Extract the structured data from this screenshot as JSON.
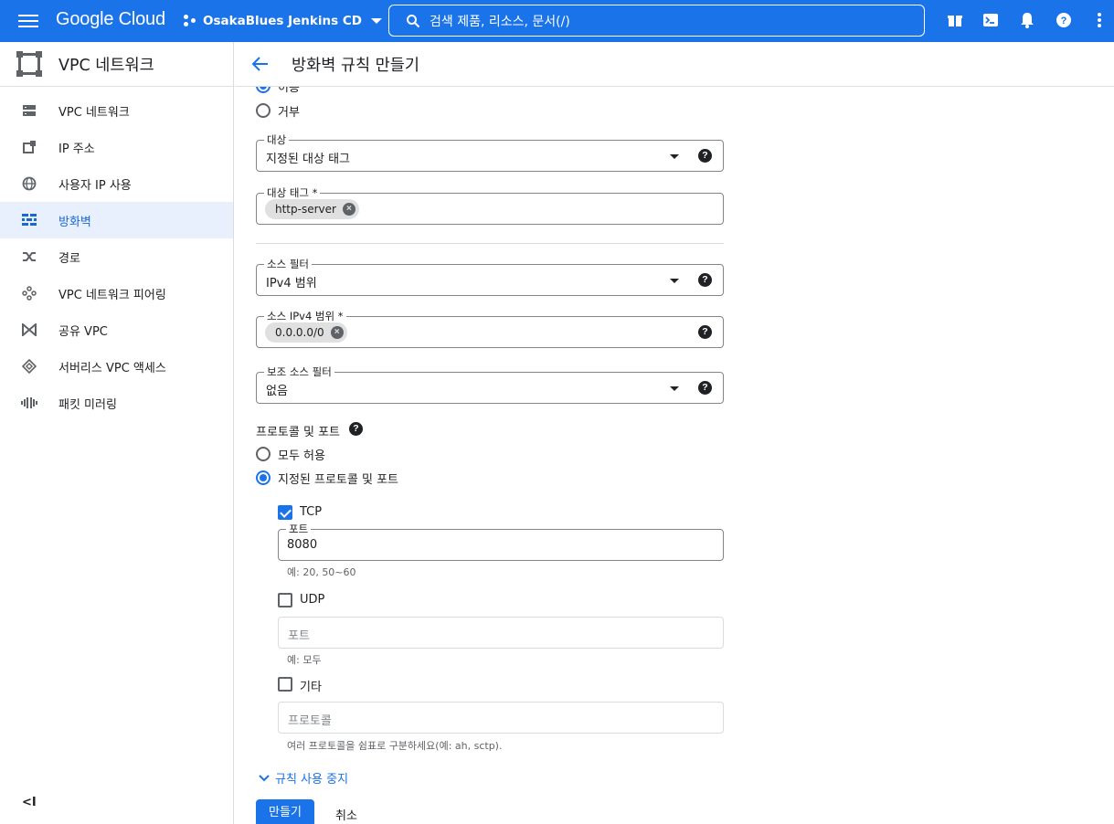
{
  "topbar": {
    "logo": "Google Cloud",
    "project": "OsakaBlues Jenkins CD",
    "search_placeholder": "검색   제품, 리소스, 문서(/)",
    "icons": [
      "gift-icon",
      "terminal-icon",
      "bell-icon",
      "help-icon",
      "more-vert-icon"
    ]
  },
  "sidebar": {
    "title": "VPC 네트워크",
    "items": [
      {
        "label": "VPC 네트워크",
        "icon": "vpc-network-icon",
        "active": false
      },
      {
        "label": "IP 주소",
        "icon": "ip-address-icon",
        "active": false
      },
      {
        "label": "사용자 IP 사용",
        "icon": "globe-icon",
        "active": false
      },
      {
        "label": "방화벽",
        "icon": "firewall-icon",
        "active": true
      },
      {
        "label": "경로",
        "icon": "routes-icon",
        "active": false
      },
      {
        "label": "VPC 네트워크 피어링",
        "icon": "peering-icon",
        "active": false
      },
      {
        "label": "공유 VPC",
        "icon": "shared-vpc-icon",
        "active": false
      },
      {
        "label": "서버리스 VPC 액세스",
        "icon": "serverless-icon",
        "active": false
      },
      {
        "label": "패킷 미러링",
        "icon": "packet-mirroring-icon",
        "active": false
      }
    ],
    "collapse_label": "<I"
  },
  "page": {
    "title": "방화벽 규칙 만들기",
    "action": {
      "option_allow": "허용",
      "option_deny": "거부",
      "selected": "allow"
    },
    "target": {
      "label": "대상",
      "value": "지정된 대상 태그"
    },
    "target_tags": {
      "label": "대상 태그 *",
      "chip": "http-server"
    },
    "source_filter": {
      "label": "소스 필터",
      "value": "IPv4 범위"
    },
    "source_ranges": {
      "label": "소스 IPv4 범위 *",
      "chip": "0.0.0.0/0"
    },
    "secondary_filter": {
      "label": "보조 소스 필터",
      "value": "없음"
    },
    "protocols": {
      "heading": "프로토콜 및 포트",
      "option_all": "모두 허용",
      "option_specified": "지정된 프로토콜 및 포트",
      "selected": "specified",
      "tcp": {
        "label": "TCP",
        "checked": true,
        "port_label": "포트",
        "port_value": "8080",
        "hint": "예: 20, 50~60"
      },
      "udp": {
        "label": "UDP",
        "checked": false,
        "port_placeholder": "포트",
        "hint": "예: 모두"
      },
      "other": {
        "label": "기타",
        "checked": false,
        "placeholder": "프로토콜",
        "hint": "여러 프로토콜을 쉼표로 구분하세요(예: ah, sctp)."
      }
    },
    "disable_rule_link": "규칙 사용 중지",
    "create_button": "만들기",
    "cancel_button": "취소"
  },
  "colors": {
    "brand": "#1a73e8",
    "active_bg": "#e8f0fe"
  }
}
